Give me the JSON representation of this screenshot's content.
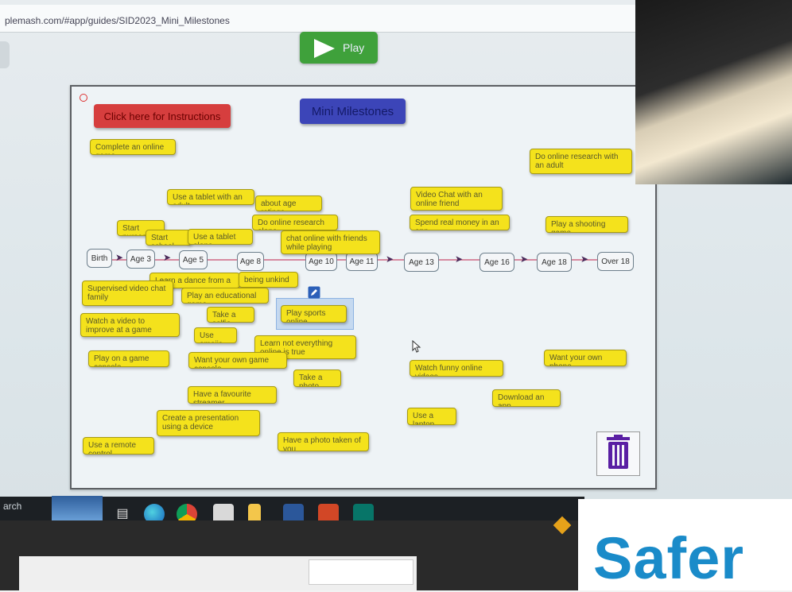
{
  "browser": {
    "url": "plemash.com/#app/guides/SID2023_Mini_Milestones",
    "play_label": "Play"
  },
  "board": {
    "instructions_label": "Click here for Instructions",
    "title": "Mini Milestones",
    "timeline": [
      "Birth",
      "Age 3",
      "Age 5",
      "Age 8",
      "Age 10",
      "Age 11",
      "Age 13",
      "Age 16",
      "Age 18",
      "Over 18"
    ],
    "cards": [
      "Complete an online game",
      "Do online research with an adult",
      "Use a tablet with an adult",
      "about age ratings",
      "Video Chat with an online friend",
      "Start nursery",
      "Start school",
      "Use a tablet alone",
      "Do online research alone",
      "Spend real money in an app",
      "Play a shooting game",
      "chat online with friends while playing",
      "Learn a dance from a video",
      "being unkind",
      "Supervised video chat family",
      "Play an educational game",
      "Play sports online",
      "Watch a video to improve at a game",
      "Take a selfie",
      "Use emojis",
      "Learn not everything online is true",
      "Play on a game console",
      "Want your own game console",
      "Watch funny online videos",
      "Want your own phone",
      "Take a photo",
      "Have a favourite streamer",
      "Download an app",
      "Create a presentation using a device",
      "Use a laptop",
      "Use a remote control",
      "Have a photo taken of you"
    ]
  },
  "taskbar": {
    "search_text": "arch"
  },
  "overlay": {
    "safer_text": "Safer"
  },
  "icons": [
    "play-icon",
    "trash-icon",
    "edit-icon",
    "mouse-cursor",
    "windows-task-view-icon",
    "edge-icon",
    "chrome-icon",
    "sims-icon",
    "file-explorer-icon",
    "word-icon",
    "powerpoint-icon",
    "publisher-icon",
    "warning-icon"
  ],
  "colors": {
    "card_yellow": "#f4e21c",
    "instructions_red": "#d63e3e",
    "title_blue": "#3c45b8",
    "play_green": "#3fa13b",
    "safer_blue": "#1a8bc9"
  }
}
